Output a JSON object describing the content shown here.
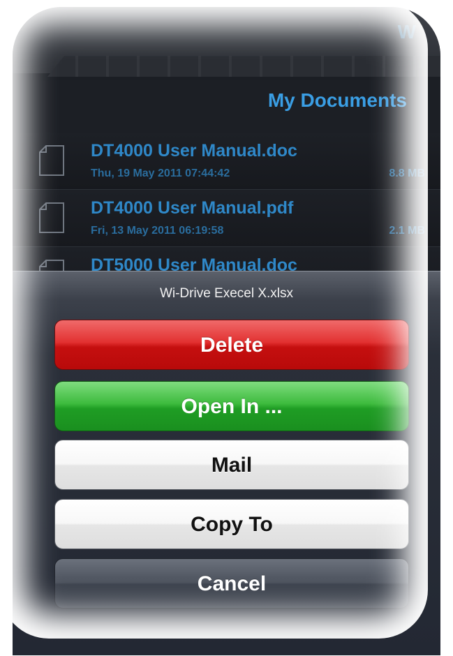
{
  "header": {
    "title": "My Documents",
    "badge_text": "W"
  },
  "files": [
    {
      "name": "DT4000 User Manual.doc",
      "date": "Thu, 19 May 2011 07:44:42",
      "size": "8.8 MB",
      "icon": "document-icon"
    },
    {
      "name": "DT4000 User Manual.pdf",
      "date": "Fri, 13 May 2011 06:19:58",
      "size": "2.1 MB",
      "icon": "document-icon"
    },
    {
      "name": "DT5000 User Manual.doc",
      "date": "",
      "size": "",
      "icon": "document-icon"
    }
  ],
  "action_sheet": {
    "title": "Wi-Drive Execel X.xlsx",
    "buttons": {
      "delete": "Delete",
      "open_in": "Open In ...",
      "mail": "Mail",
      "copy_to": "Copy To",
      "cancel": "Cancel"
    }
  },
  "colors": {
    "accent_blue": "#3a9ee4",
    "delete_red": "#d11a1a",
    "open_green": "#2aa52f",
    "sheet_bg": "#2a2f39"
  }
}
